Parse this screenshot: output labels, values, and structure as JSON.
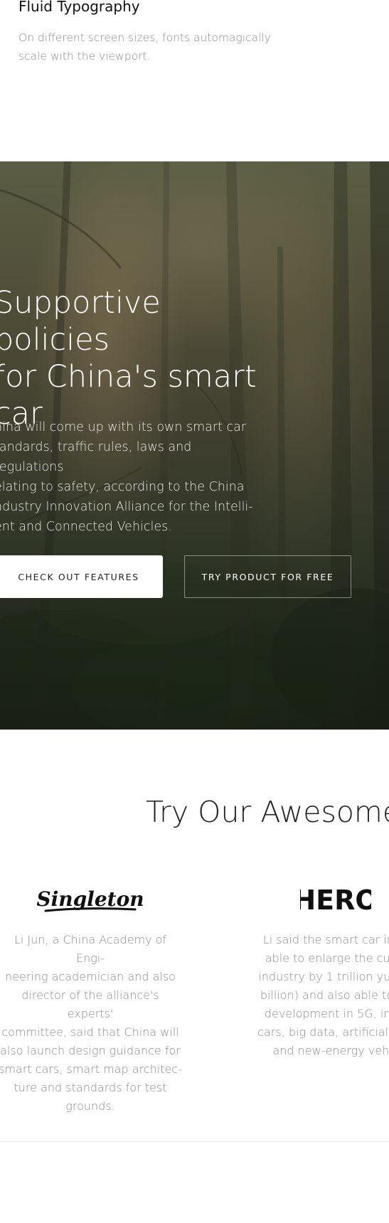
{
  "top": {
    "title": "Fluid Typography",
    "description": "On different screen sizes, fonts automagically scale with the viewport."
  },
  "hero": {
    "title": "Supportive policies\nfor China's smart\ncar",
    "body": "hina will come up with its own smart car\ntandards, traffic rules, laws and regulations\nelating to safety, according to the China\nndustry Innovation Alliance for the Intelli-\nent and Connected Vehicles.",
    "primary_button": "CHECK OUT FEATURES",
    "secondary_button": "TRY PRODUCT FOR FREE"
  },
  "features": {
    "title": "Try Our Awesome",
    "items": [
      {
        "logo": "Singleton",
        "description": "Li Jun, a China Academy of Engi-\nneering academician and also\ndirector of the alliance's experts'\ncommittee, said that China will\nalso launch design guidance for\nsmart cars, smart map architec-\nture and standards for test\ngrounds."
      },
      {
        "logo": "HERO",
        "description": "Li said the smart car indu\nable to enlarge the curre\nindustry by 1 trillion yuan (\nbillion) and also able to bo\ndevelopment in 5G, inter\ncars, big data, artificial inte\nand new-energy vehic"
      }
    ]
  }
}
